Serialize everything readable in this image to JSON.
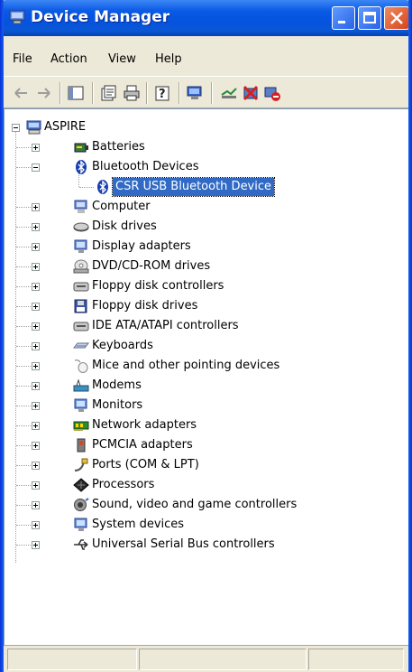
{
  "window": {
    "title": "Device Manager"
  },
  "menu": {
    "file": "File",
    "action": "Action",
    "view": "View",
    "help": "Help"
  },
  "tree": {
    "root": "ASPIRE",
    "batteries": "Batteries",
    "bluetooth": "Bluetooth Devices",
    "bt_device": "CSR USB Bluetooth Device",
    "computer": "Computer",
    "disk": "Disk drives",
    "display": "Display adapters",
    "dvd": "DVD/CD-ROM drives",
    "floppy_ctrl": "Floppy disk controllers",
    "floppy": "Floppy disk drives",
    "ide": "IDE ATA/ATAPI controllers",
    "keyboards": "Keyboards",
    "mice": "Mice and other pointing devices",
    "modems": "Modems",
    "monitors": "Monitors",
    "network": "Network adapters",
    "pcmcia": "PCMCIA adapters",
    "ports": "Ports (COM & LPT)",
    "processors": "Processors",
    "sound": "Sound, video and game controllers",
    "system": "System devices",
    "usb": "Universal Serial Bus controllers"
  },
  "colors": {
    "titlebar": "#0553e0",
    "selection": "#316ac5",
    "chrome": "#ece9d8"
  }
}
